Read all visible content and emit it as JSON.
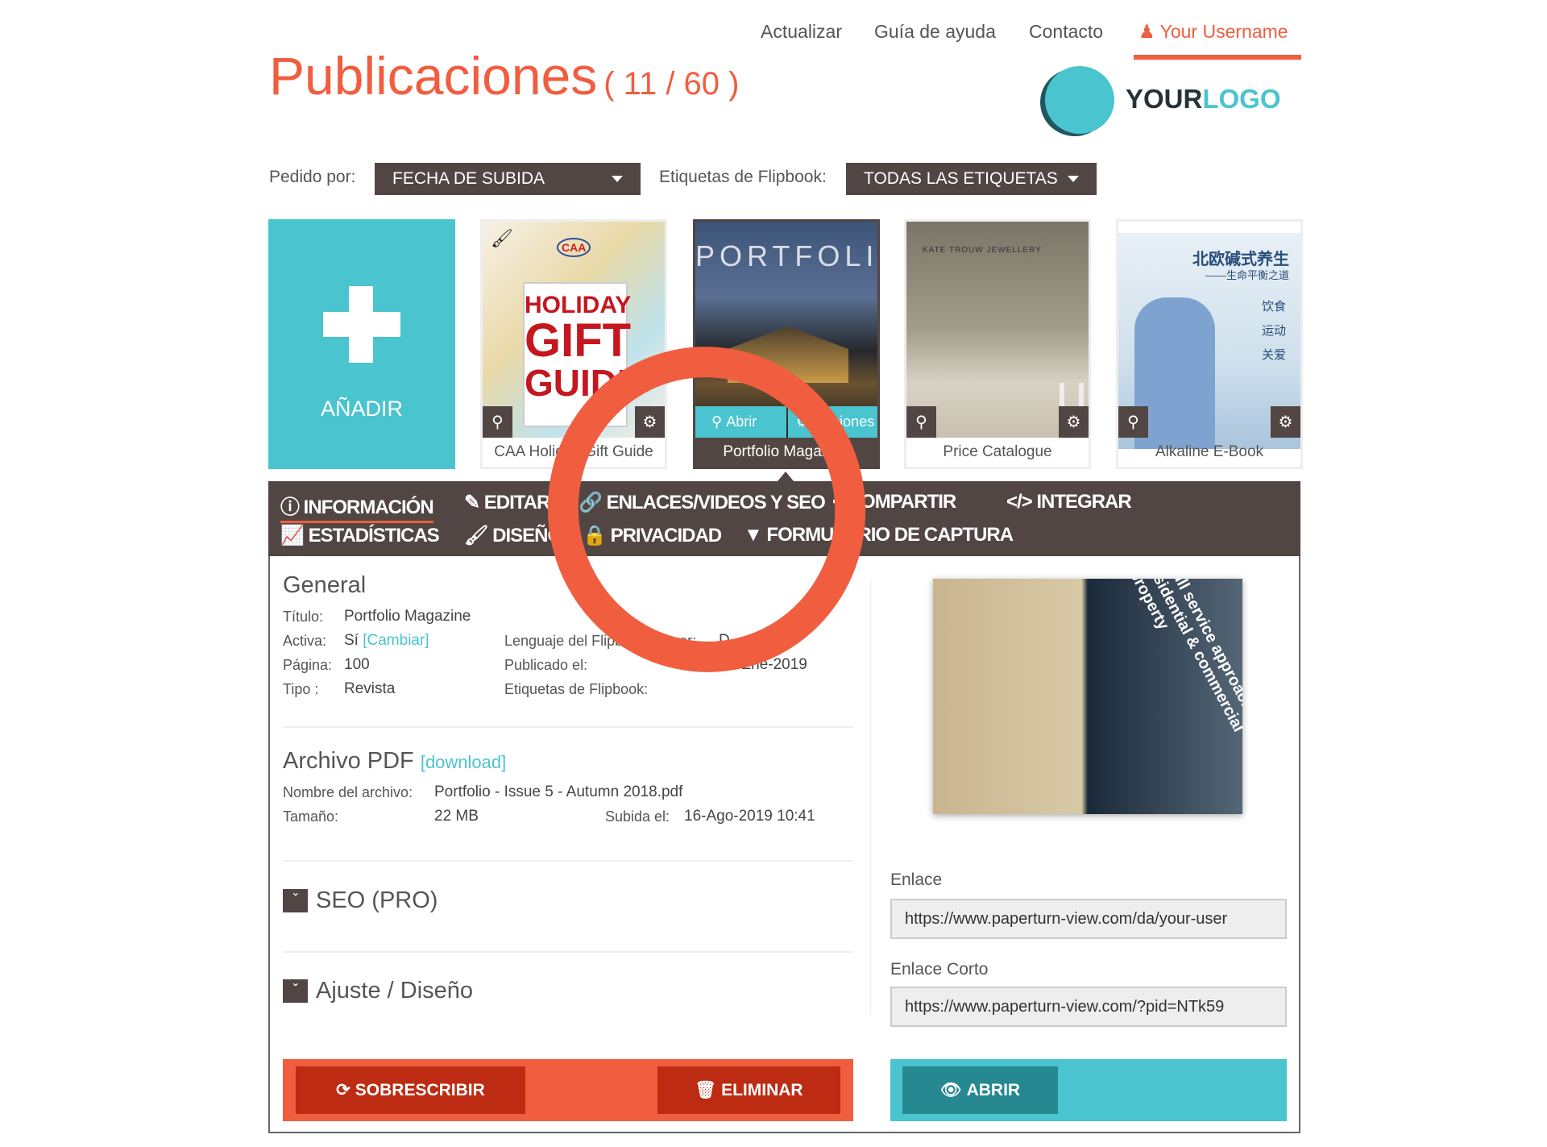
{
  "topnav": {
    "update": "Actualizar",
    "help": "Guía de ayuda",
    "contact": "Contacto",
    "username": "Your Username"
  },
  "header": {
    "title": "Publicaciones",
    "count": "( 11 / 60 )"
  },
  "logo": {
    "part1": "YOUR",
    "part2": "LOGO"
  },
  "filters": {
    "order_label": "Pedido por:",
    "order_value": "FECHA DE SUBIDA",
    "tags_label": "Etiquetas de Flipbook:",
    "tags_value": "TODAS LAS ETIQUETAS"
  },
  "add_card": {
    "label": "AÑADIR"
  },
  "publications": [
    {
      "caption": "CAA Holiday Gift Guide",
      "cover_text": [
        "CAA",
        "HOLIDAY",
        "GIFT",
        "GUIDE"
      ]
    },
    {
      "caption": "Portfolio Magazine",
      "cover_text": [
        "PORTFOLIO"
      ],
      "open_label": "Abrir",
      "options_label": "Opciones"
    },
    {
      "caption": "Price Catalogue",
      "cover_text": [
        "KATE TROUW JEWELLERY"
      ]
    },
    {
      "caption": "Alkaline E-Book",
      "cover_text": [
        "北欧碱式养生",
        "——生命平衡之道",
        "饮食",
        "运动",
        "关爱"
      ]
    }
  ],
  "tabs": {
    "row1": [
      "INFORMACIÓN",
      "EDITAR",
      "ENLACES/VIDEOS Y SEO",
      "COMPARTIR",
      "INTEGRAR"
    ],
    "row2": [
      "ESTADÍSTICAS",
      "DISEÑO",
      "PRIVACIDAD",
      "FORMULARIO DE CAPTURA"
    ]
  },
  "general": {
    "heading": "General",
    "title_label": "Título:",
    "title_value": "Portfolio Magazine",
    "active_label": "Activa:",
    "active_value": "Sí",
    "change_link": "[Cambiar]",
    "page_label": "Página:",
    "page_value": "100",
    "type_label": "Tipo :",
    "type_value": "Revista",
    "language_label": "Lenguaje del Flipbook viewer:",
    "language_value": "D",
    "published_label": "Publicado el:",
    "published_value": "16-Ene-2019",
    "tags_label": "Etiquetas de Flipbook:"
  },
  "pdf": {
    "heading": "Archivo PDF",
    "download": "[download]",
    "filename_label": "Nombre del archivo:",
    "filename": "Portfolio - Issue 5 - Autumn 2018.pdf",
    "size_label": "Tamaño:",
    "size": "22 MB",
    "uploaded_label": "Subida el:",
    "uploaded": "16-Ago-2019 10:41"
  },
  "sections": {
    "seo": "SEO (PRO)",
    "layout": "Ajuste / Diseño"
  },
  "links": {
    "link_label": "Enlace",
    "link_value": "https://www.paperturn-view.com/da/your-user",
    "short_label": "Enlace Corto",
    "short_value": "https://www.paperturn-view.com/?pid=NTk59"
  },
  "preview_text": "A full service approach to residential & commercial property",
  "actions": {
    "overwrite": "SOBRESCRIBIR",
    "delete": "ELIMINAR",
    "open": "ABRIR"
  },
  "colors": {
    "accent": "#f15d3f",
    "teal": "#4ac4cf",
    "dark": "#514643",
    "danger_button": "#bd2c12",
    "teal_button": "#268890"
  }
}
